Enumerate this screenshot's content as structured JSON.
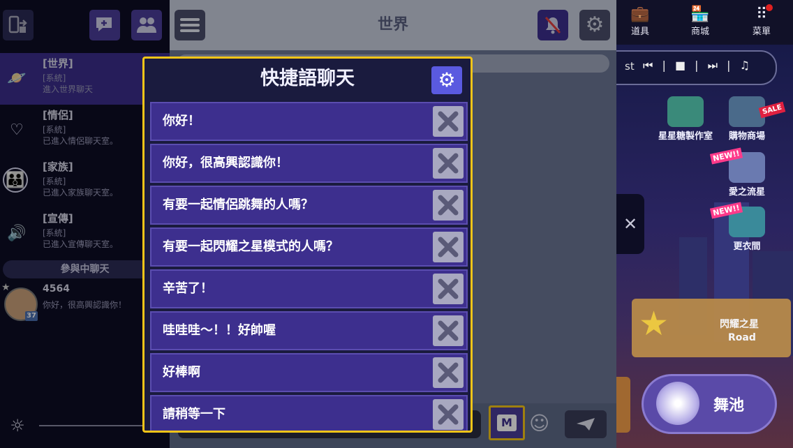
{
  "sidebar": {
    "channels": [
      {
        "name": "[世界]",
        "sub1": "[系統]",
        "sub2": "進入世界聊天"
      },
      {
        "name": "[情侶]",
        "sub1": "[系統]",
        "sub2": "已進入情侶聊天室。"
      },
      {
        "name": "[家族]",
        "sub1": "[系統]",
        "sub2": "已進入家族聊天室。"
      },
      {
        "name": "[宣傳]",
        "sub1": "[系統]",
        "sub2": "已進入宣傳聊天室。"
      }
    ],
    "joined_label": "參與中聊天",
    "dm": {
      "name": "4564",
      "message": "你好，很高興認識你！",
      "level": "37"
    }
  },
  "chat": {
    "title": "世界",
    "m_label": "M"
  },
  "game": {
    "top": [
      {
        "label": "道具",
        "icon": "bag-icon"
      },
      {
        "label": "商城",
        "icon": "shop-icon"
      },
      {
        "label": "菜單",
        "icon": "menu-grid-icon"
      }
    ],
    "music_text": "st",
    "icons": [
      {
        "label": "星星糖製作室"
      },
      {
        "label": "購物商場",
        "badge": "SALE"
      },
      {
        "label": "愛之流星",
        "badge": "NEW!!"
      },
      {
        "label": "更衣間",
        "badge": "NEW!!"
      }
    ],
    "event_title": "閃耀之星",
    "event_sub": "Road",
    "dance_label": "舞池"
  },
  "modal": {
    "title": "快捷語聊天",
    "phrases": [
      "你好！",
      "你好，很高興認識你！",
      "有要一起情侶跳舞的人嗎？",
      "有要一起閃耀之星模式的人嗎？",
      "辛苦了！",
      "哇哇哇～！！好帥喔",
      "好棒啊",
      "請稍等一下"
    ]
  }
}
